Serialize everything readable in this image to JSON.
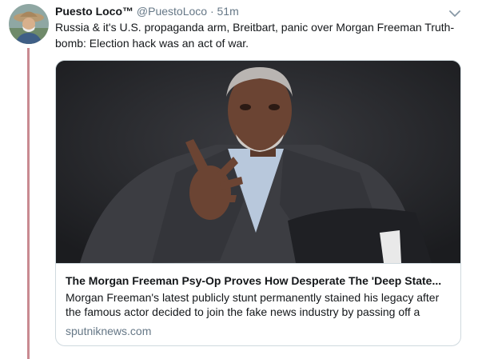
{
  "tweet": {
    "author": {
      "display_name": "Puesto Loco™",
      "handle": "@PuestoLoco",
      "separator": "·",
      "time": "51m"
    },
    "text": "Russia & it's U.S. propaganda arm, Breitbart, panic over Morgan Freeman Truth-bomb: Election hack was an act of war.",
    "card": {
      "title": "The Morgan Freeman Psy-Op Proves How Desperate The 'Deep State...",
      "description": "Morgan Freeman's latest publicly stunt permanently stained his legacy after the famous actor decided to join the fake news industry by passing off a",
      "domain": "sputniknews.com"
    }
  },
  "icons": {
    "caret": "chevron-down-icon"
  },
  "colors": {
    "thread_line": "#c98a91",
    "secondary_text": "#657786",
    "border": "#cfd9de"
  }
}
